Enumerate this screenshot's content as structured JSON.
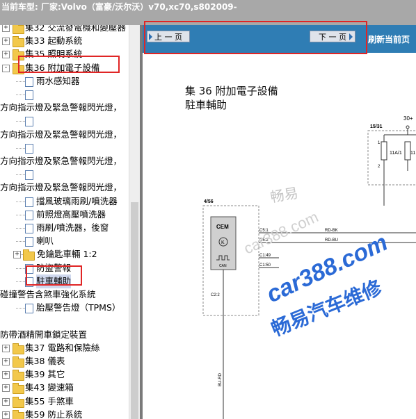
{
  "header": {
    "title": "当前车型:  厂家:Volvo（富豪/沃尔沃）v70,xc70,s802009-"
  },
  "tree": {
    "items": [
      {
        "label": "集32 交流發電機和變壓器",
        "type": "folder",
        "indent": 0,
        "expander": "+"
      },
      {
        "label": "集33 起動系統",
        "type": "folder",
        "indent": 0,
        "expander": "+"
      },
      {
        "label": "集35 照明系統",
        "type": "folder",
        "indent": 0,
        "expander": "+"
      },
      {
        "label": "集36 附加電子設備",
        "type": "folder",
        "indent": 0,
        "expander": "-"
      },
      {
        "label": "雨水感知器",
        "type": "doc",
        "indent": 2
      },
      {
        "label": "",
        "type": "doc",
        "indent": 2
      },
      {
        "label": "方向指示燈及緊急警報閃光燈，",
        "type": "text",
        "indent": 0
      },
      {
        "label": "",
        "type": "doc",
        "indent": 2
      },
      {
        "label": "方向指示燈及緊急警報閃光燈，",
        "type": "text",
        "indent": 0
      },
      {
        "label": "",
        "type": "doc",
        "indent": 2
      },
      {
        "label": "方向指示燈及緊急警報閃光燈，",
        "type": "text",
        "indent": 0
      },
      {
        "label": "",
        "type": "doc",
        "indent": 2
      },
      {
        "label": "方向指示燈及緊急警報閃光燈，",
        "type": "text",
        "indent": 0
      },
      {
        "label": "擋風玻璃雨刷/噴洗器",
        "type": "doc",
        "indent": 2
      },
      {
        "label": "前照燈高壓噴洗器",
        "type": "doc",
        "indent": 2
      },
      {
        "label": "雨刷/噴洗器，後窗",
        "type": "doc",
        "indent": 2
      },
      {
        "label": "喇叭",
        "type": "doc",
        "indent": 2
      },
      {
        "label": "免鑰匙車輛 1:2",
        "type": "folder",
        "indent": 1,
        "expander": "+"
      },
      {
        "label": "防盜警報",
        "type": "doc",
        "indent": 2
      },
      {
        "label": "駐車輔助",
        "type": "doc",
        "indent": 2,
        "selected": true
      },
      {
        "label": "碰撞警告含煞車強化系統",
        "type": "text",
        "indent": 0
      },
      {
        "label": "胎壓警告燈（TPMS）",
        "type": "doc",
        "indent": 2
      },
      {
        "label": "",
        "type": "text",
        "indent": 0
      },
      {
        "label": "防帶酒精開車鎖定裝置",
        "type": "text",
        "indent": 0
      },
      {
        "label": "集37 電路和保險絲",
        "type": "folder",
        "indent": 0,
        "expander": "+"
      },
      {
        "label": "集38 儀表",
        "type": "folder",
        "indent": 0,
        "expander": "+"
      },
      {
        "label": "集39 其它",
        "type": "folder",
        "indent": 0,
        "expander": "+"
      },
      {
        "label": "集43 變速箱",
        "type": "folder",
        "indent": 0,
        "expander": "+"
      },
      {
        "label": "集55 手煞車",
        "type": "folder",
        "indent": 0,
        "expander": "+"
      },
      {
        "label": "集59 防止系統",
        "type": "folder",
        "indent": 0,
        "expander": "+"
      }
    ]
  },
  "toolbar": {
    "prev_label": "上 一 页",
    "next_label": "下 一 页",
    "refresh_label": "刷新当前页"
  },
  "document": {
    "title_line1": "集 36 附加電子設備",
    "title_line2": "駐車輔助"
  },
  "diagram": {
    "fuse_group": "15/31",
    "supply": "30+",
    "fuse_label": "11A/1",
    "fuse_label2": "11",
    "fuse_top_pin": "1",
    "fuse_bottom_pin": "2",
    "module_ref": "4/56",
    "module_name": "CEM",
    "can_label": "CAN",
    "pin_c5_1": "C5:1",
    "pin_c5_2": "C5:2",
    "pin_c1_49": "C1:49",
    "pin_c1_50": "C1:50",
    "pin_c2_2": "C2:2",
    "wire_rd_bk": "RD-BK",
    "wire_rd_bu": "RD-BU",
    "wire_bu_rd": "BU-RD"
  },
  "watermark": {
    "cn_small": "畅易",
    "site": "car388.com",
    "cn_big": "畅易汽车维修",
    "faint": "car388.com"
  },
  "colors": {
    "titlebar": "#a8a8a8",
    "toolbar": "#2f7db4",
    "highlight": "#e02525",
    "watermark": "#2b6ad6"
  }
}
